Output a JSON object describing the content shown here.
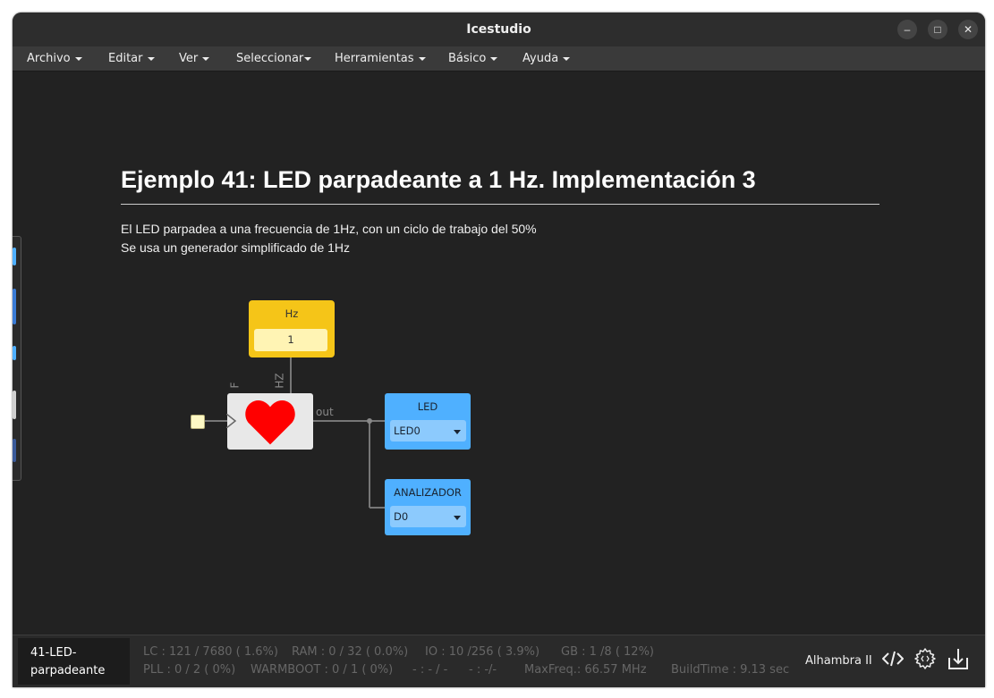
{
  "window": {
    "title": "Icestudio"
  },
  "window_controls": {
    "minimize": "–",
    "maximize": "□",
    "close": "✕"
  },
  "menu": [
    "Archivo",
    "Editar",
    "Ver",
    "Seleccionar",
    "Herramientas",
    "Básico",
    "Ayuda"
  ],
  "canvas": {
    "heading": "Ejemplo 41: LED parpadeante a 1 Hz. Implementación 3",
    "desc_line1": "El LED parpadea a una frecuencia de 1Hz, con un ciclo de trabajo del 50%",
    "desc_line2": "Se usa un generador simplificado de 1Hz",
    "hz_block": {
      "label": "Hz",
      "value": "1"
    },
    "generator": {
      "port_f": "F",
      "port_hz": "HZ",
      "port_out": "out",
      "heart_color": "#ff0000"
    },
    "led_block": {
      "label": "LED",
      "pin": "LED0"
    },
    "analyzer_block": {
      "label": "ANALIZADOR",
      "pin": "D0"
    },
    "colors": {
      "constant": "#f5c518",
      "output": "#4fb0ff",
      "wire": "#777777"
    }
  },
  "status": {
    "project_line1": "41-LED-",
    "project_line2": "parpadeante",
    "lc": "LC : 121 / 7680 ( 1.6%)",
    "ram": "RAM : 0 / 32 ( 0.0%)",
    "io": "IO : 10 /256 ( 3.9%)",
    "gb": "GB : 1 /8 ( 12%)",
    "pll": "PLL : 0 / 2 ( 0%)",
    "warmboot": "WARMBOOT : 0 / 1 ( 0%)",
    "misc1": "- : - / -",
    "misc2": "- : -/-",
    "maxfreq": "MaxFreq.: 66.57 MHz",
    "buildtime": "BuildTime : 9.13 sec",
    "board": "Alhambra II",
    "icons": [
      "code-icon",
      "settings-gear-icon",
      "download-icon"
    ]
  }
}
